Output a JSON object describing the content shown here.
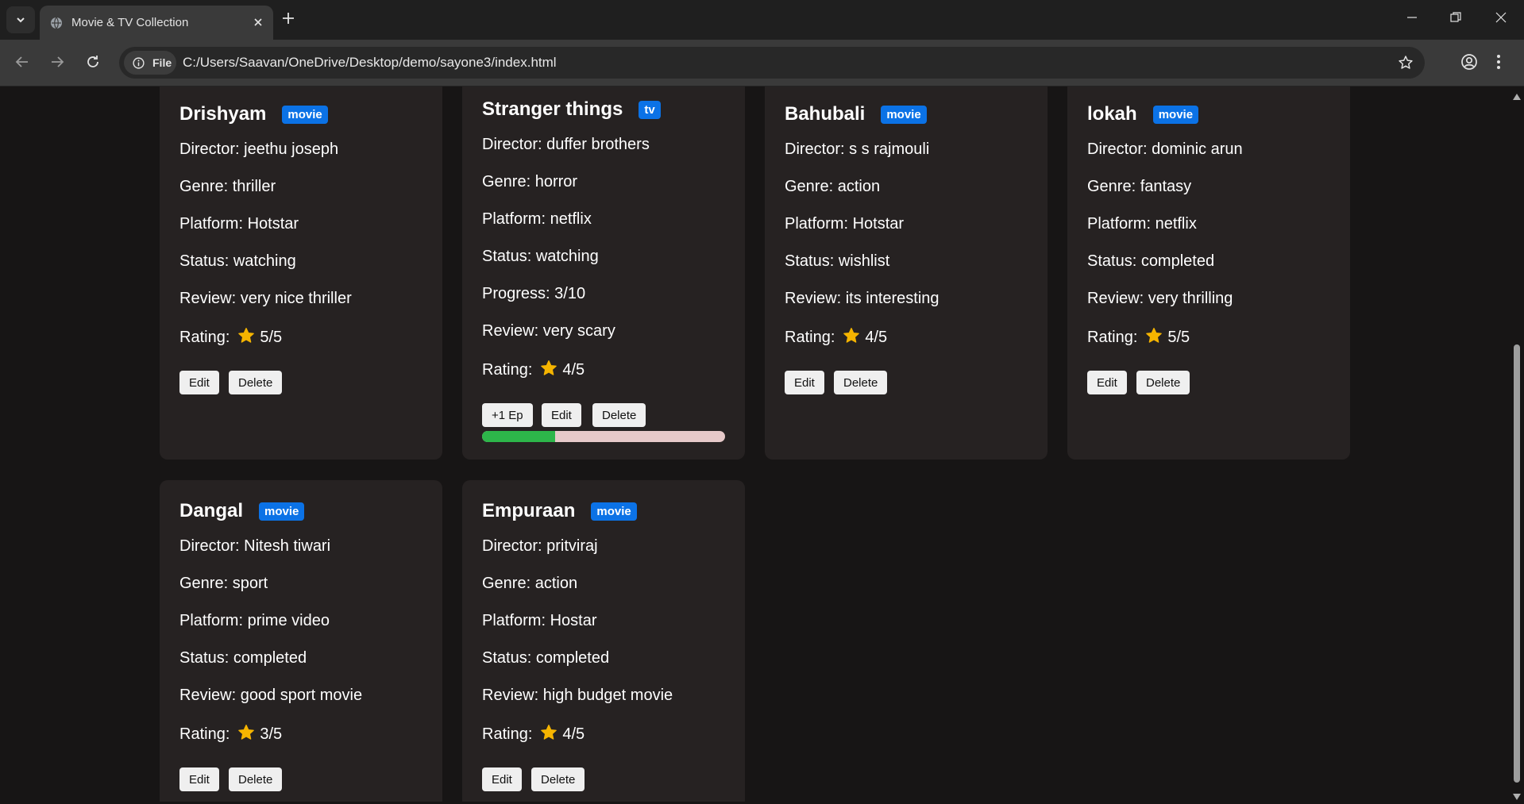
{
  "browser": {
    "tab_title": "Movie & TV Collection",
    "security_chip": "File",
    "url": "C:/Users/Saavan/OneDrive/Desktop/demo/sayone3/index.html"
  },
  "cards": [
    {
      "title": "Drishyam",
      "badge": "movie",
      "director": "Director: jeethu joseph",
      "genre": "Genre: thriller",
      "platform": "Platform: Hotstar",
      "status": "Status: watching",
      "review": "Review: very nice thriller",
      "rating_label": "Rating:",
      "rating": "5/5",
      "edit": "Edit",
      "delete": "Delete"
    },
    {
      "title": "Stranger things",
      "badge": "tv",
      "director": "Director: duffer brothers",
      "genre": "Genre: horror",
      "platform": "Platform: netflix",
      "status": "Status: watching",
      "progress": "Progress: 3/10",
      "progress_fraction": 0.3,
      "review": "Review: very scary",
      "rating_label": "Rating:",
      "rating": "4/5",
      "ep": "+1 Ep",
      "edit": "Edit",
      "delete": "Delete"
    },
    {
      "title": "Bahubali",
      "badge": "movie",
      "director": "Director: s s rajmouli",
      "genre": "Genre: action",
      "platform": "Platform: Hotstar",
      "status": "Status: wishlist",
      "review": "Review: its interesting",
      "rating_label": "Rating:",
      "rating": "4/5",
      "edit": "Edit",
      "delete": "Delete"
    },
    {
      "title": "lokah",
      "badge": "movie",
      "director": "Director: dominic arun",
      "genre": "Genre: fantasy",
      "platform": "Platform: netflix",
      "status": "Status: completed",
      "review": "Review: very thrilling",
      "rating_label": "Rating:",
      "rating": "5/5",
      "edit": "Edit",
      "delete": "Delete"
    },
    {
      "title": "Dangal",
      "badge": "movie",
      "director": "Director: Nitesh tiwari",
      "genre": "Genre: sport",
      "platform": "Platform: prime video",
      "status": "Status: completed",
      "review": "Review: good sport movie",
      "rating_label": "Rating:",
      "rating": "3/5",
      "edit": "Edit",
      "delete": "Delete"
    },
    {
      "title": "Empuraan",
      "badge": "movie",
      "director": "Director: pritviraj",
      "genre": "Genre: action",
      "platform": "Platform: Hostar",
      "status": "Status: completed",
      "review": "Review: high budget movie",
      "rating_label": "Rating:",
      "rating": "4/5",
      "edit": "Edit",
      "delete": "Delete"
    }
  ],
  "colors": {
    "badge": "#0b72e6",
    "progress_fill": "#2db64a",
    "progress_track": "#e6c9c9",
    "star": "#f5b400",
    "card_bg": "#262222",
    "page_bg": "#171515"
  },
  "icons": {
    "tab_search": "chevron-down-icon",
    "favicon": "globe-icon",
    "tab_close": "close-icon",
    "new_tab": "plus-icon",
    "back": "arrow-left-icon",
    "forward": "arrow-right-icon",
    "reload": "reload-icon",
    "info": "info-icon",
    "bookmark": "star-outline-icon",
    "profile": "profile-icon",
    "menu": "kebab-menu-icon",
    "rating": "star-icon"
  }
}
